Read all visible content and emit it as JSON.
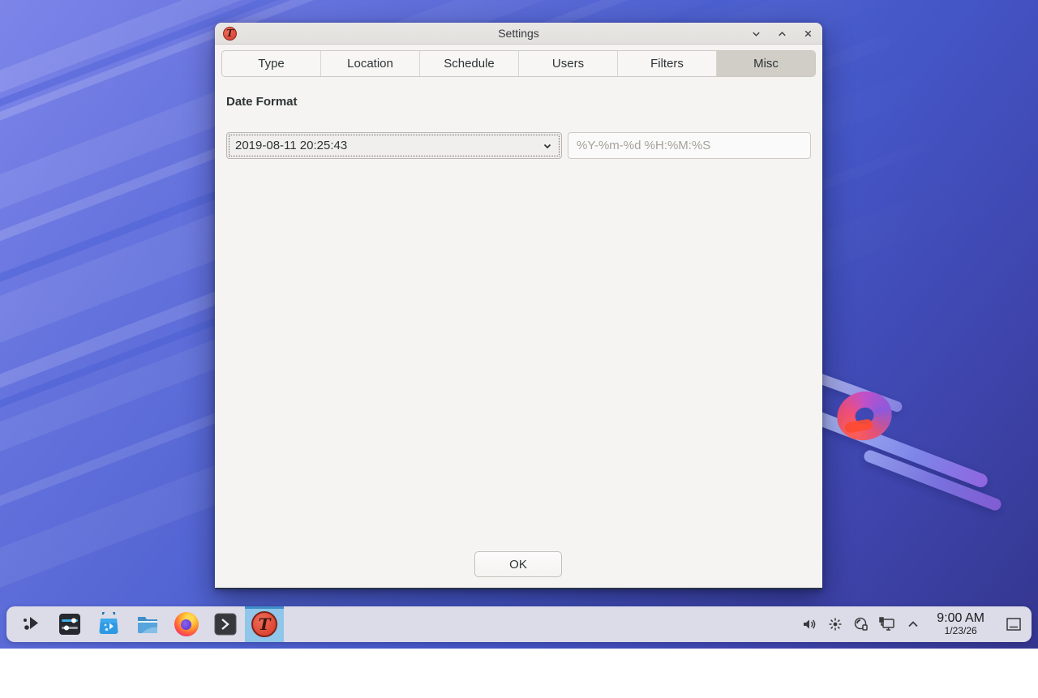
{
  "window": {
    "title": "Settings",
    "app_icon": "timeshift-icon",
    "app_glyph": "T",
    "controls": {
      "minimize": "chevron-down",
      "maximize": "chevron-up",
      "close": "x"
    },
    "tabs": [
      {
        "label": "Type",
        "active": false
      },
      {
        "label": "Location",
        "active": false
      },
      {
        "label": "Schedule",
        "active": false
      },
      {
        "label": "Users",
        "active": false
      },
      {
        "label": "Filters",
        "active": false
      },
      {
        "label": "Misc",
        "active": true
      }
    ],
    "content": {
      "section_label": "Date Format",
      "dropdown_value": "2019-08-11 20:25:43",
      "format_input_value": "",
      "format_input_placeholder": "%Y-%m-%d %H:%M:%S",
      "ok_label": "OK"
    }
  },
  "taskbar": {
    "launcher_icon": "app-launcher-icon",
    "app_icons": [
      "system-settings-icon",
      "discover-icon",
      "dolphin-icon",
      "firefox-icon",
      "konsole-icon",
      "timeshift-icon"
    ],
    "active_app": "timeshift",
    "tray_icons": [
      "volume-icon",
      "brightness-icon",
      "disc-devices-icon",
      "display-connect-icon",
      "expand-tray-icon"
    ],
    "clock": {
      "time": "9:00 AM",
      "date": "1/23/26"
    },
    "peek_icon": "show-desktop-icon"
  },
  "colors": {
    "tab_active_bg": "#d1cdc7",
    "dialog_bg": "#f5f4f2",
    "panel_bg": "#dcdbe8",
    "task_highlight": "#8fc6e9",
    "task_highlight_bar": "#3f8fc9",
    "app_icon_red": "#de4734",
    "wallpaper_top": "#7d85e9",
    "wallpaper_bottom": "#34368e"
  }
}
